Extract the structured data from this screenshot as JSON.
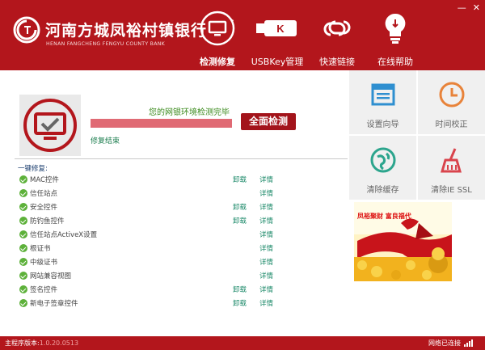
{
  "header": {
    "bank_name": "河南方城凤裕村镇银行",
    "bank_name_en": "HENAN FANGCHENG FENGYU COUNTY BANK",
    "nav": [
      {
        "label": "检测修复",
        "icon": "monitor-refresh-icon",
        "active": true
      },
      {
        "label": "USBKey管理",
        "icon": "usb-key-icon",
        "active": false
      },
      {
        "label": "快速链接",
        "icon": "link-icon",
        "active": false
      },
      {
        "label": "在线帮助",
        "icon": "lightbulb-icon",
        "active": false
      }
    ],
    "window_controls": {
      "minimize": "—",
      "close": "✕"
    }
  },
  "main": {
    "status_text": "您的网银环境检测完毕",
    "progress": 1.0,
    "check_button": "全面检测",
    "repair_done": "修复结束",
    "section_title": "一键修复:",
    "items": [
      {
        "name": "MAC控件",
        "uninstall": "卸载",
        "detail": "详情"
      },
      {
        "name": "信任站点",
        "uninstall": "",
        "detail": "详情"
      },
      {
        "name": "安全控件",
        "uninstall": "卸载",
        "detail": "详情"
      },
      {
        "name": "防钓鱼控件",
        "uninstall": "卸载",
        "detail": "详情"
      },
      {
        "name": "信任站点ActiveX设置",
        "uninstall": "",
        "detail": "详情"
      },
      {
        "name": "根证书",
        "uninstall": "",
        "detail": "详情"
      },
      {
        "name": "中级证书",
        "uninstall": "",
        "detail": "详情"
      },
      {
        "name": "网站兼容视图",
        "uninstall": "",
        "detail": "详情"
      },
      {
        "name": "签名控件",
        "uninstall": "卸载",
        "detail": "详情"
      },
      {
        "name": "新电子签章控件",
        "uninstall": "卸载",
        "detail": "详情"
      }
    ]
  },
  "tiles": [
    {
      "label": "设置向导",
      "icon": "wizard-window-icon"
    },
    {
      "label": "时间校正",
      "icon": "clock-icon"
    },
    {
      "label": "清除缓存",
      "icon": "globe-icon"
    },
    {
      "label": "清除IE SSL",
      "icon": "broom-icon"
    }
  ],
  "ad": {
    "text": "凤裕聚财  富良福代"
  },
  "footer": {
    "version_label": "主程序版本:",
    "version_number": "1.0.20.0513",
    "network_status": "网络已连接"
  },
  "colors": {
    "brand_red": "#b3161c",
    "link_green": "#1d8a6a",
    "ok_green": "#5db13a"
  }
}
